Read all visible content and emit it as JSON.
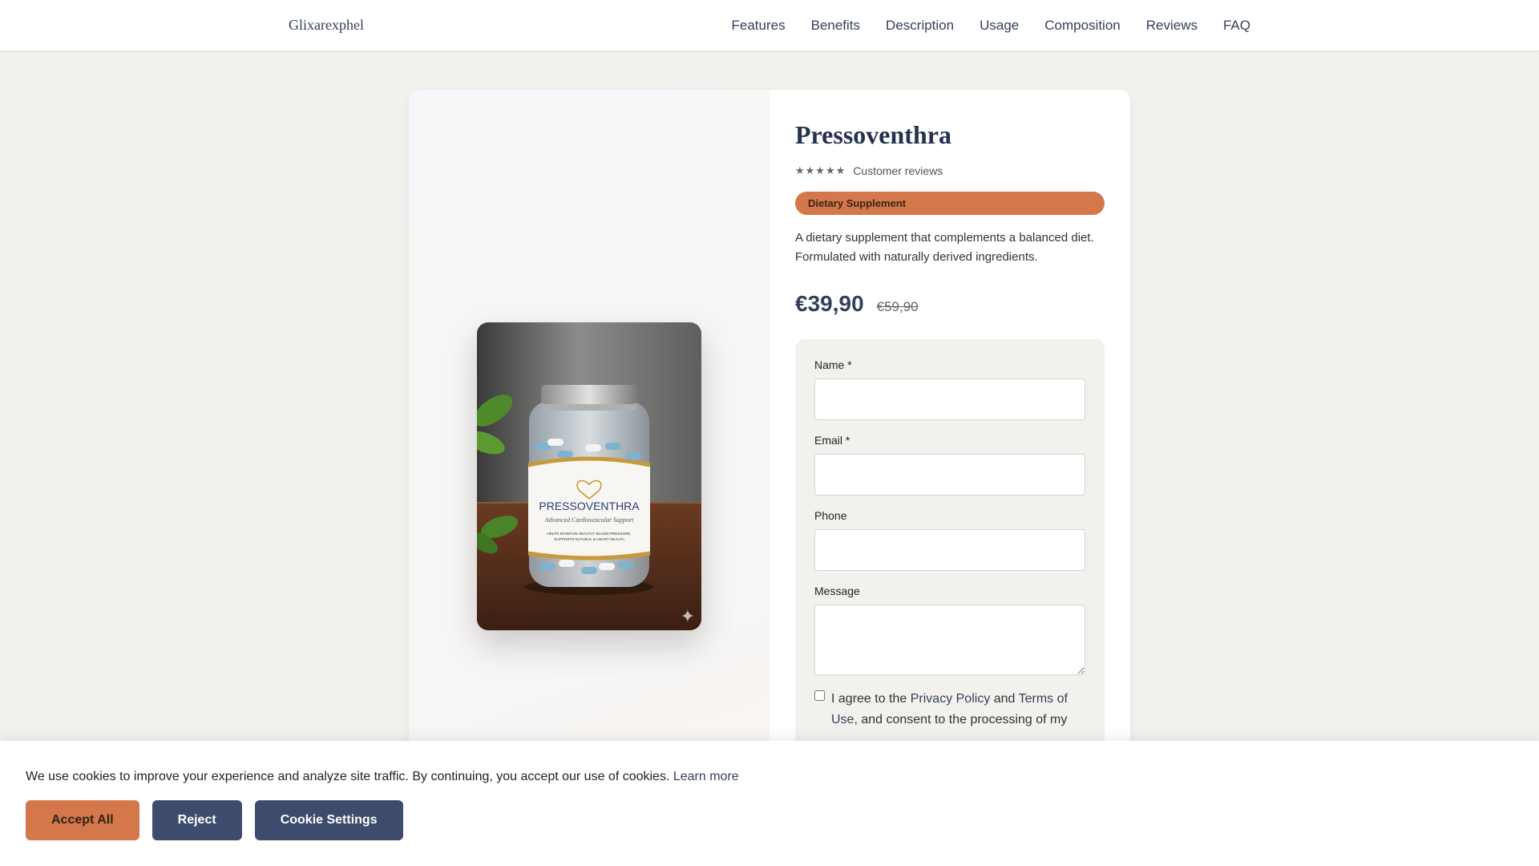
{
  "header": {
    "brand": "Glixarexphel",
    "nav": [
      "Features",
      "Benefits",
      "Description",
      "Usage",
      "Composition",
      "Reviews",
      "FAQ"
    ]
  },
  "product": {
    "title": "Pressoventhra",
    "stars": "★★★★★",
    "rating_label": "Customer reviews",
    "badge": "Dietary Supplement",
    "description": "A dietary supplement that complements a balanced diet. Formulated with naturally derived ingredients.",
    "price": "€39,90",
    "old_price": "€59,90",
    "image_label": {
      "brand": "PRESSOVENTHRA",
      "tagline": "Advanced Cardiovascular Support",
      "claim_1": "HELPS MAINTAIN HEALTHY BLOOD PRESSURE,",
      "claim_2": "SUPPORTS NATURAL & HEART HEALTH"
    }
  },
  "form": {
    "name_label": "Name *",
    "name_value": "",
    "email_label": "Email *",
    "email_value": "",
    "phone_label": "Phone",
    "phone_value": "",
    "message_label": "Message",
    "message_value": "",
    "consent_prefix": "I agree to the ",
    "privacy_link": "Privacy Policy",
    "consent_and": " and ",
    "terms_link": "Terms of Use",
    "consent_suffix": ", and consent to the processing of my"
  },
  "cookie": {
    "text": "We use cookies to improve your experience and analyze site traffic. By continuing, you accept our use of cookies.",
    "learn_more": "Learn more",
    "accept": "Accept All",
    "reject": "Reject",
    "settings": "Cookie Settings"
  },
  "colors": {
    "accent": "#d4774a",
    "navy": "#34405a",
    "background": "#f2f1ed"
  }
}
